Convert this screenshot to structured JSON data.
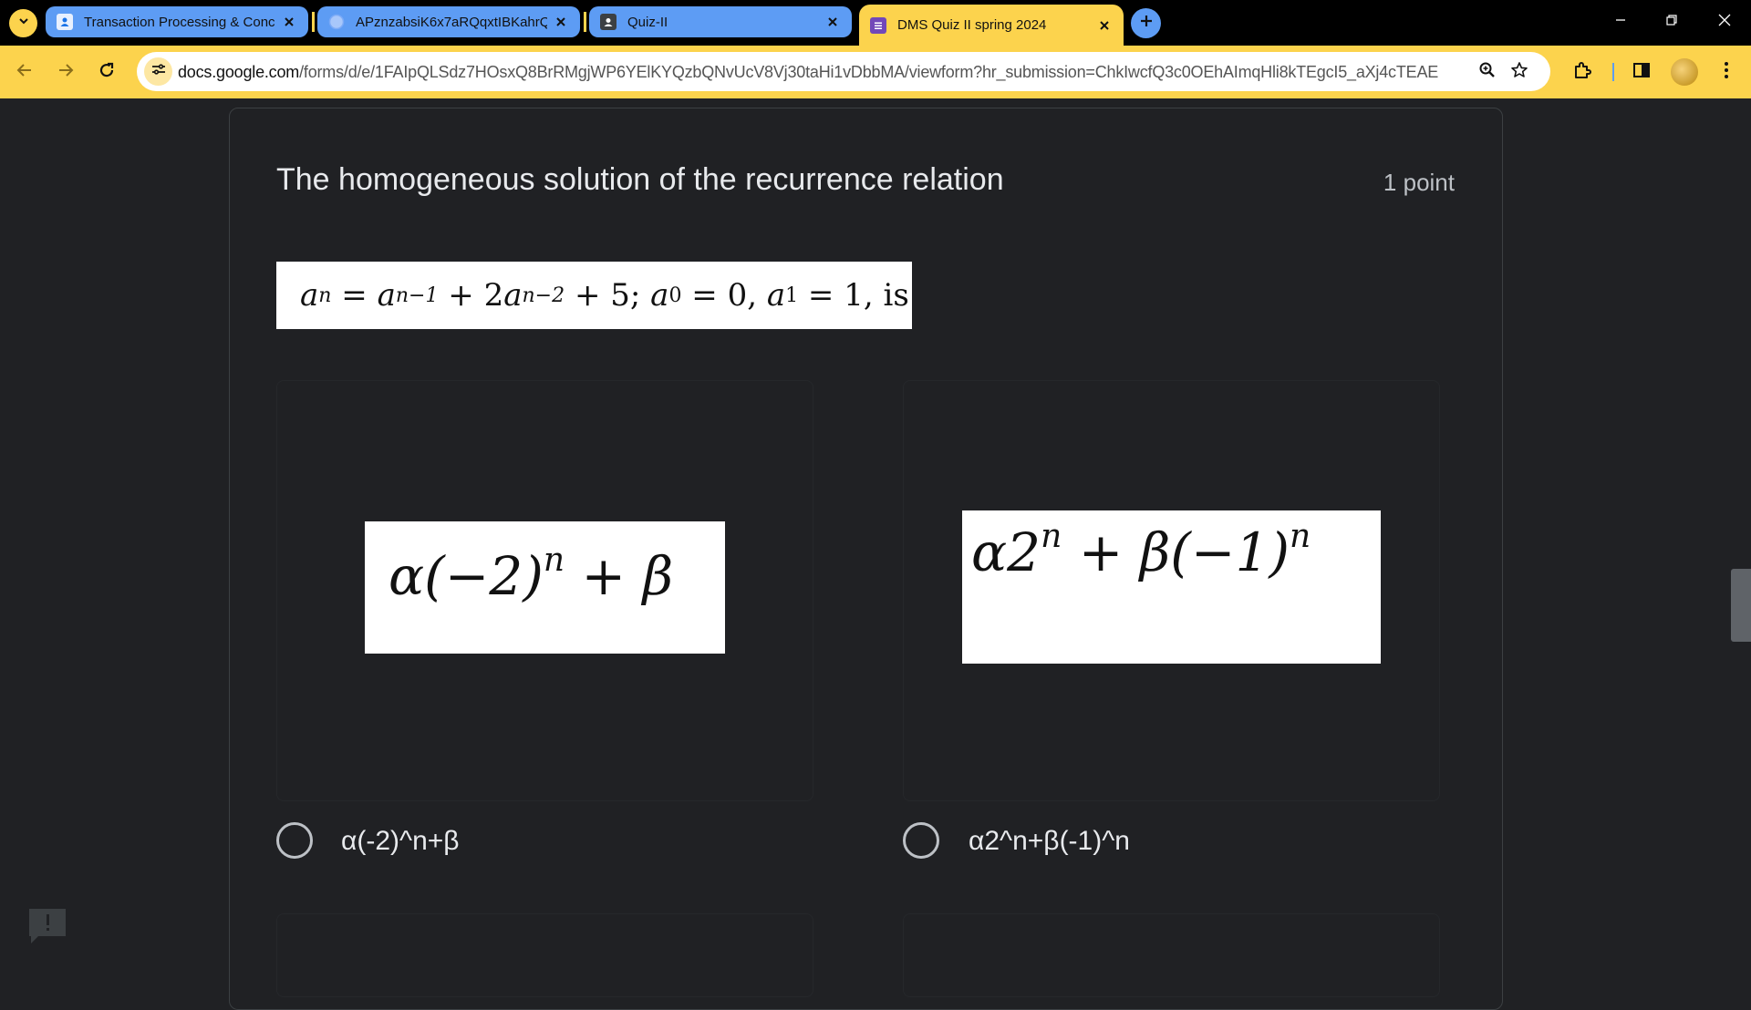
{
  "browser": {
    "tabs": [
      {
        "title": "Transaction Processing & Conc",
        "favicon": "person-icon",
        "active": false
      },
      {
        "title": "APznzabsiK6x7aRQqxtIBKahrQ",
        "favicon": "google-icon",
        "active": false
      },
      {
        "title": "Quiz-II",
        "favicon": "classroom-icon",
        "active": false
      },
      {
        "title": "DMS Quiz II spring 2024",
        "favicon": "forms-icon",
        "active": true
      }
    ],
    "url_host": "docs.google.com",
    "url_path": "/forms/d/e/1FAIpQLSdz7HOsxQ8BrRMgjWP6YElKYQzbQNvUcV8Vj30taHi1vDbbMA/viewform?hr_submission=ChkIwcfQ3c0OEhAImqHli8kTEgcI5_aXj4cTEAE",
    "theme_color": "#fcd34d",
    "tab_color": "#5d9cf4"
  },
  "question": {
    "title": "The homogeneous solution of the recurrence relation",
    "points": "1 point",
    "image_text": {
      "a": "a",
      "n": "n",
      "n1": "n−1",
      "n2": "n−2",
      "sub0": "0",
      "sub1": "1",
      "eq": "=",
      "plus": "+",
      "two": "2",
      "five": "5;",
      "zero": "0,",
      "one": "1, is"
    },
    "options": [
      {
        "label": "α(-2)^n+β",
        "image_main": "α(−2)",
        "image_sup": "n",
        "image_tail": " + β"
      },
      {
        "label": "α2^n+β(-1)^n",
        "image_main": "α2",
        "image_sup": "n",
        "image_mid": " + β(−1)",
        "image_sup2": "n"
      }
    ]
  }
}
